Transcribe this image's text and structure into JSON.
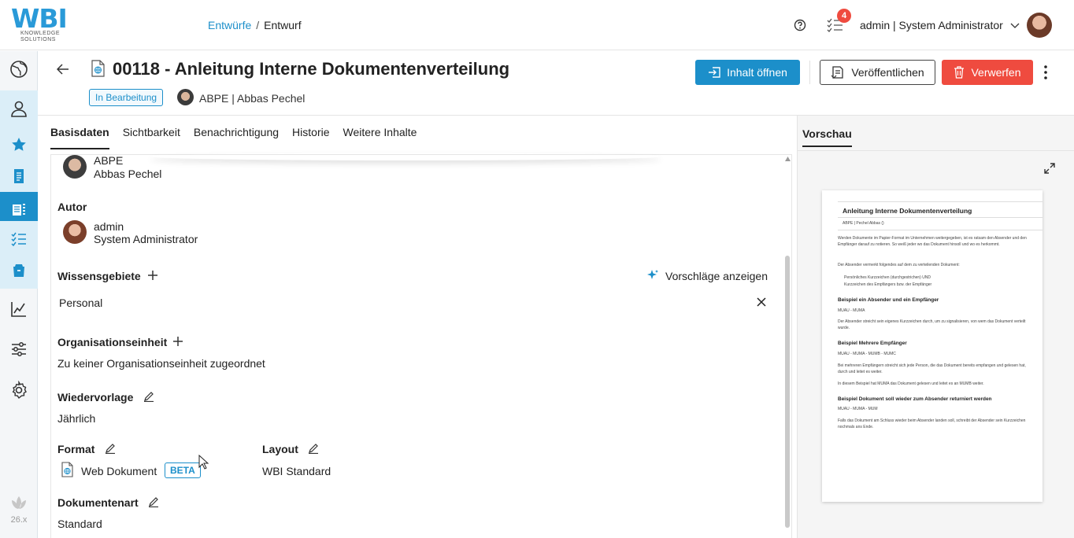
{
  "topbar": {
    "logo_main": "WBI",
    "logo_sub1": "KNOWLEDGE",
    "logo_sub2": "SOLUTIONS",
    "breadcrumb": [
      {
        "label": "Entwürfe"
      },
      {
        "label": "Entwurf"
      }
    ],
    "breadcrumb_sep": "/",
    "tasks_count": "4",
    "user_label": "admin | System Administrator"
  },
  "sidebar": {
    "version": "26.x"
  },
  "header": {
    "title": "00118 - Anleitung Interne Dokumentenverteilung",
    "status": "In Bearbeitung",
    "owner": "ABPE | Abbas Pechel",
    "btn_open": "Inhalt öffnen",
    "btn_publish": "Veröffentlichen",
    "btn_discard": "Verwerfen"
  },
  "tabs": [
    {
      "label": "Basisdaten",
      "active": true
    },
    {
      "label": "Sichtbarkeit"
    },
    {
      "label": "Benachrichtigung"
    },
    {
      "label": "Historie"
    },
    {
      "label": "Weitere Inhalte"
    }
  ],
  "form": {
    "owner_short": "ABPE",
    "owner_full": "Abbas Pechel",
    "author_label": "Autor",
    "author_short": "admin",
    "author_full": "System Administrator",
    "knowledge_label": "Wissensgebiete",
    "suggestions_label": "Vorschläge anzeigen",
    "knowledge_value": "Personal",
    "orgunit_label": "Organisationseinheit",
    "orgunit_value": "Zu keiner Organisationseinheit zugeordnet",
    "resubmission_label": "Wiedervorlage",
    "resubmission_value": "Jährlich",
    "format_label": "Format",
    "format_value": "Web Dokument",
    "format_badge": "BETA",
    "layout_label": "Layout",
    "layout_value": "WBI Standard",
    "doctype_label": "Dokumentenart",
    "doctype_value": "Standard"
  },
  "preview": {
    "tab_label": "Vorschau",
    "doc_title": "Anleitung Interne Dokumentenverteilung",
    "doc_meta": "ABPE | Pechel Abbas ()",
    "p1": "Werden Dokumente im Papier-Format im Unternehmen weitergegeben, ist es ratsam den Absender und den Empfänger darauf zu notieren. So weiß jeder wo das Dokument hinsoll und wo es herkommt.",
    "p2": "Der Absender vermerkt folgendes auf dem zu verteilenden Dokument:",
    "li1": "Persönliches Kurzzeichen (durchgestrichen) UND",
    "li2": "Kurzzeichen des Empfängers bzw. der Empfänger",
    "h1": "Beispiel ein Absender und ein Empfänger",
    "ex1": "MUAU - MUMA",
    "p3": "Der Absender streicht sein eigenes Kurzzeichen durch, um zu signalisieren, von wem das Dokument verteilt wurde.",
    "h2": "Beispiel Mehrere Empfänger",
    "ex2": "MUAU - MUMA - MUMB - MUMC",
    "p4": "Bei mehreren Empfängern streicht sich jede Person, die das Dokument bereits empfangen und gelesen hat, durch und leitet es weiter.",
    "p5": "In diesem Beispiel hat MUMA das Dokument gelesen und leitet es an MUMB weiter.",
    "h3": "Beispiel Dokument soll wieder zum Absender returniert werden",
    "ex3": "MUAU - MUMA - MUM",
    "p6": "Falls das Dokument am Schluss wieder beim Absender landen soll, schreibt der Absender sein Kurzzeichen nochmals ans Ende."
  },
  "colors": {
    "brand": "#1c8fca",
    "danger": "#ef4b3f"
  }
}
